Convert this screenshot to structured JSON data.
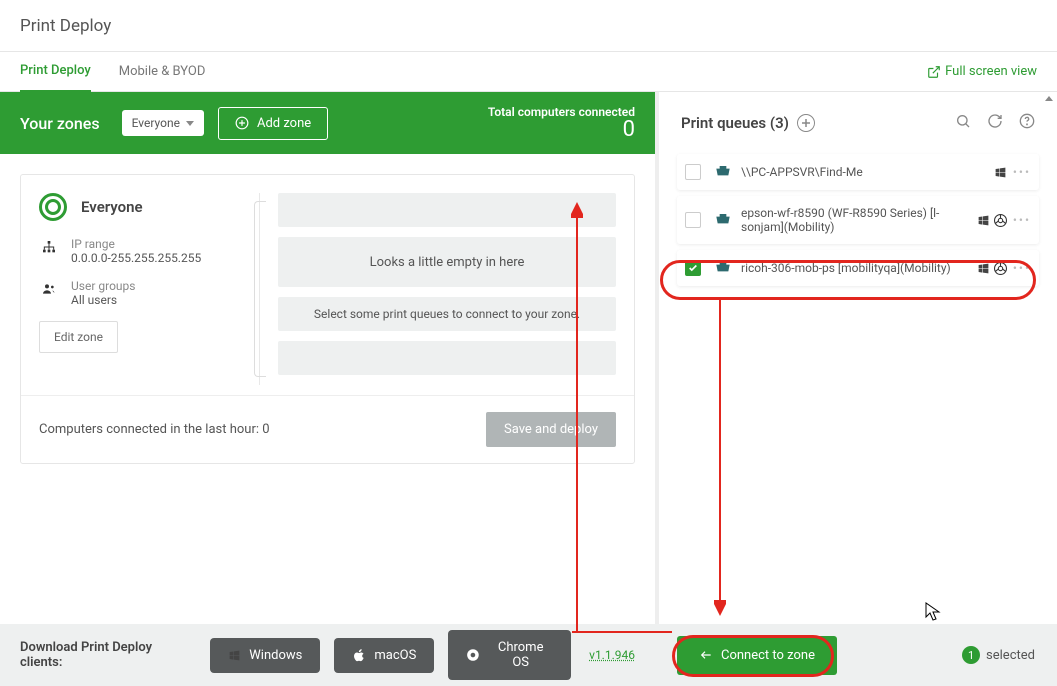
{
  "header": {
    "title": "Print Deploy"
  },
  "tabs": {
    "active": "Print Deploy",
    "other": "Mobile & BYOD",
    "fullscreen": "Full screen view"
  },
  "green_bar": {
    "title": "Your zones",
    "select": "Everyone",
    "add_zone": "Add zone",
    "connected_label": "Total computers connected",
    "connected_count": "0"
  },
  "zone": {
    "name": "Everyone",
    "ip_label": "IP range",
    "ip_value": "0.0.0.0-255.255.255.255",
    "groups_label": "User groups",
    "groups_value": "All users",
    "edit": "Edit zone",
    "empty_title": "Looks a little empty in here",
    "empty_sub": "Select some print queues to connect to your zone.",
    "footer_label": "Computers connected in the last hour:",
    "footer_count": "0",
    "save": "Save and deploy"
  },
  "print_queues": {
    "title": "Print queues (3)",
    "items": [
      {
        "name": "\\\\PC-APPSVR\\Find-Me",
        "checked": false,
        "os": [
          "windows"
        ]
      },
      {
        "name": "epson-wf-r8590 (WF-R8590 Series) [l-sonjam](Mobility)",
        "checked": false,
        "os": [
          "windows",
          "chrome"
        ]
      },
      {
        "name": "ricoh-306-mob-ps [mobilityqa](Mobility)",
        "checked": true,
        "os": [
          "windows",
          "chrome"
        ]
      }
    ]
  },
  "footer": {
    "download_label": "Download Print Deploy clients:",
    "windows": "Windows",
    "macos": "macOS",
    "chromeos": "Chrome OS",
    "version": "v1.1.946",
    "connect": "Connect to zone",
    "selected_count": "1",
    "selected_label": "selected"
  }
}
